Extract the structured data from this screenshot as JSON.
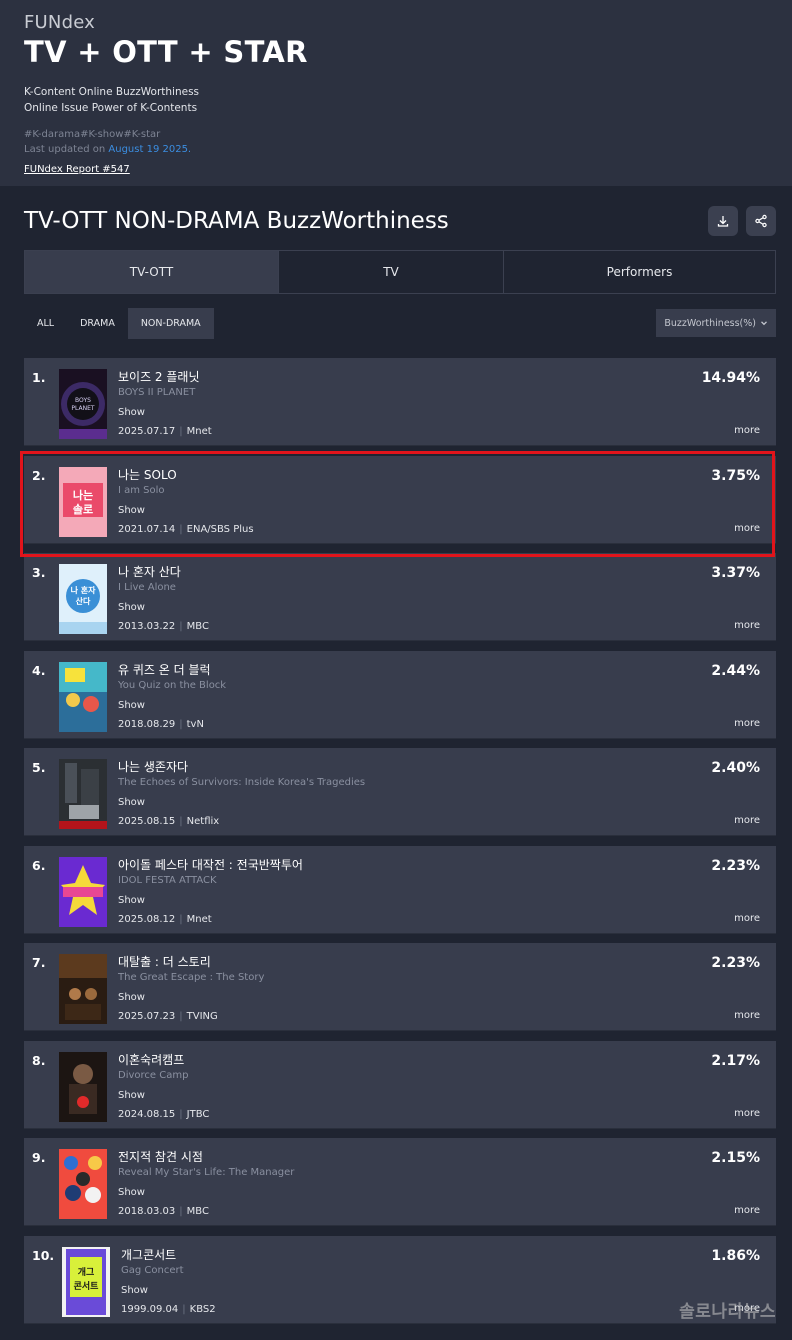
{
  "header": {
    "brand": "FUNdex",
    "title": "TV + OTT + STAR",
    "tagline_1": "K-Content Online BuzzWorthiness",
    "tagline_2": "Online Issue Power of K-Contents",
    "hashtags": "#K-darama#K-show#K-star",
    "updated_prefix": "Last updated on ",
    "updated_date": "August 19 2025.",
    "report_link": "FUNdex Report #547"
  },
  "section": {
    "title": "TV-OTT NON-DRAMA BuzzWorthiness",
    "download_icon": "download-icon",
    "share_icon": "share-icon"
  },
  "tabs": [
    {
      "label": "TV-OTT",
      "active": true
    },
    {
      "label": "TV",
      "active": false
    },
    {
      "label": "Performers",
      "active": false
    }
  ],
  "filters": {
    "pills": [
      {
        "label": "ALL",
        "active": false
      },
      {
        "label": "DRAMA",
        "active": false
      },
      {
        "label": "NON-DRAMA",
        "active": true
      }
    ],
    "sort_label": "BuzzWorthiness(%)"
  },
  "items": [
    {
      "rank": "1.",
      "title_ko": "보이즈 2 플래닛",
      "title_en": "BOYS II PLANET",
      "genre": "Show",
      "date": "2025.07.17",
      "channel": "Mnet",
      "percent": "14.94%",
      "more": "more"
    },
    {
      "rank": "2.",
      "title_ko": "나는 SOLO",
      "title_en": "I am Solo",
      "genre": "Show",
      "date": "2021.07.14",
      "channel": "ENA/SBS Plus",
      "percent": "3.75%",
      "more": "more"
    },
    {
      "rank": "3.",
      "title_ko": "나 혼자 산다",
      "title_en": "I Live Alone",
      "genre": "Show",
      "date": "2013.03.22",
      "channel": "MBC",
      "percent": "3.37%",
      "more": "more"
    },
    {
      "rank": "4.",
      "title_ko": "유 퀴즈 온 더 블럭",
      "title_en": "You Quiz on the Block",
      "genre": "Show",
      "date": "2018.08.29",
      "channel": "tvN",
      "percent": "2.44%",
      "more": "more"
    },
    {
      "rank": "5.",
      "title_ko": "나는 생존자다",
      "title_en": "The Echoes of Survivors: Inside Korea's Tragedies",
      "genre": "Show",
      "date": "2025.08.15",
      "channel": "Netflix",
      "percent": "2.40%",
      "more": "more"
    },
    {
      "rank": "6.",
      "title_ko": "아이돌 페스타 대작전 : 전국반짝투어",
      "title_en": "IDOL FESTA ATTACK",
      "genre": "Show",
      "date": "2025.08.12",
      "channel": "Mnet",
      "percent": "2.23%",
      "more": "more"
    },
    {
      "rank": "7.",
      "title_ko": "대탈출 : 더 스토리",
      "title_en": "The Great Escape : The Story",
      "genre": "Show",
      "date": "2025.07.23",
      "channel": "TVING",
      "percent": "2.23%",
      "more": "more"
    },
    {
      "rank": "8.",
      "title_ko": "이혼숙려캠프",
      "title_en": "Divorce Camp",
      "genre": "Show",
      "date": "2024.08.15",
      "channel": "JTBC",
      "percent": "2.17%",
      "more": "more"
    },
    {
      "rank": "9.",
      "title_ko": "전지적 참견 시점",
      "title_en": "Reveal My Star's Life: The Manager",
      "genre": "Show",
      "date": "2018.03.03",
      "channel": "MBC",
      "percent": "2.15%",
      "more": "more"
    },
    {
      "rank": "10.",
      "title_ko": "개그콘서트",
      "title_en": "Gag Concert",
      "genre": "Show",
      "date": "1999.09.04",
      "channel": "KBS2",
      "percent": "1.86%",
      "more": "more"
    }
  ],
  "watermark": "솔로나라뉴스"
}
